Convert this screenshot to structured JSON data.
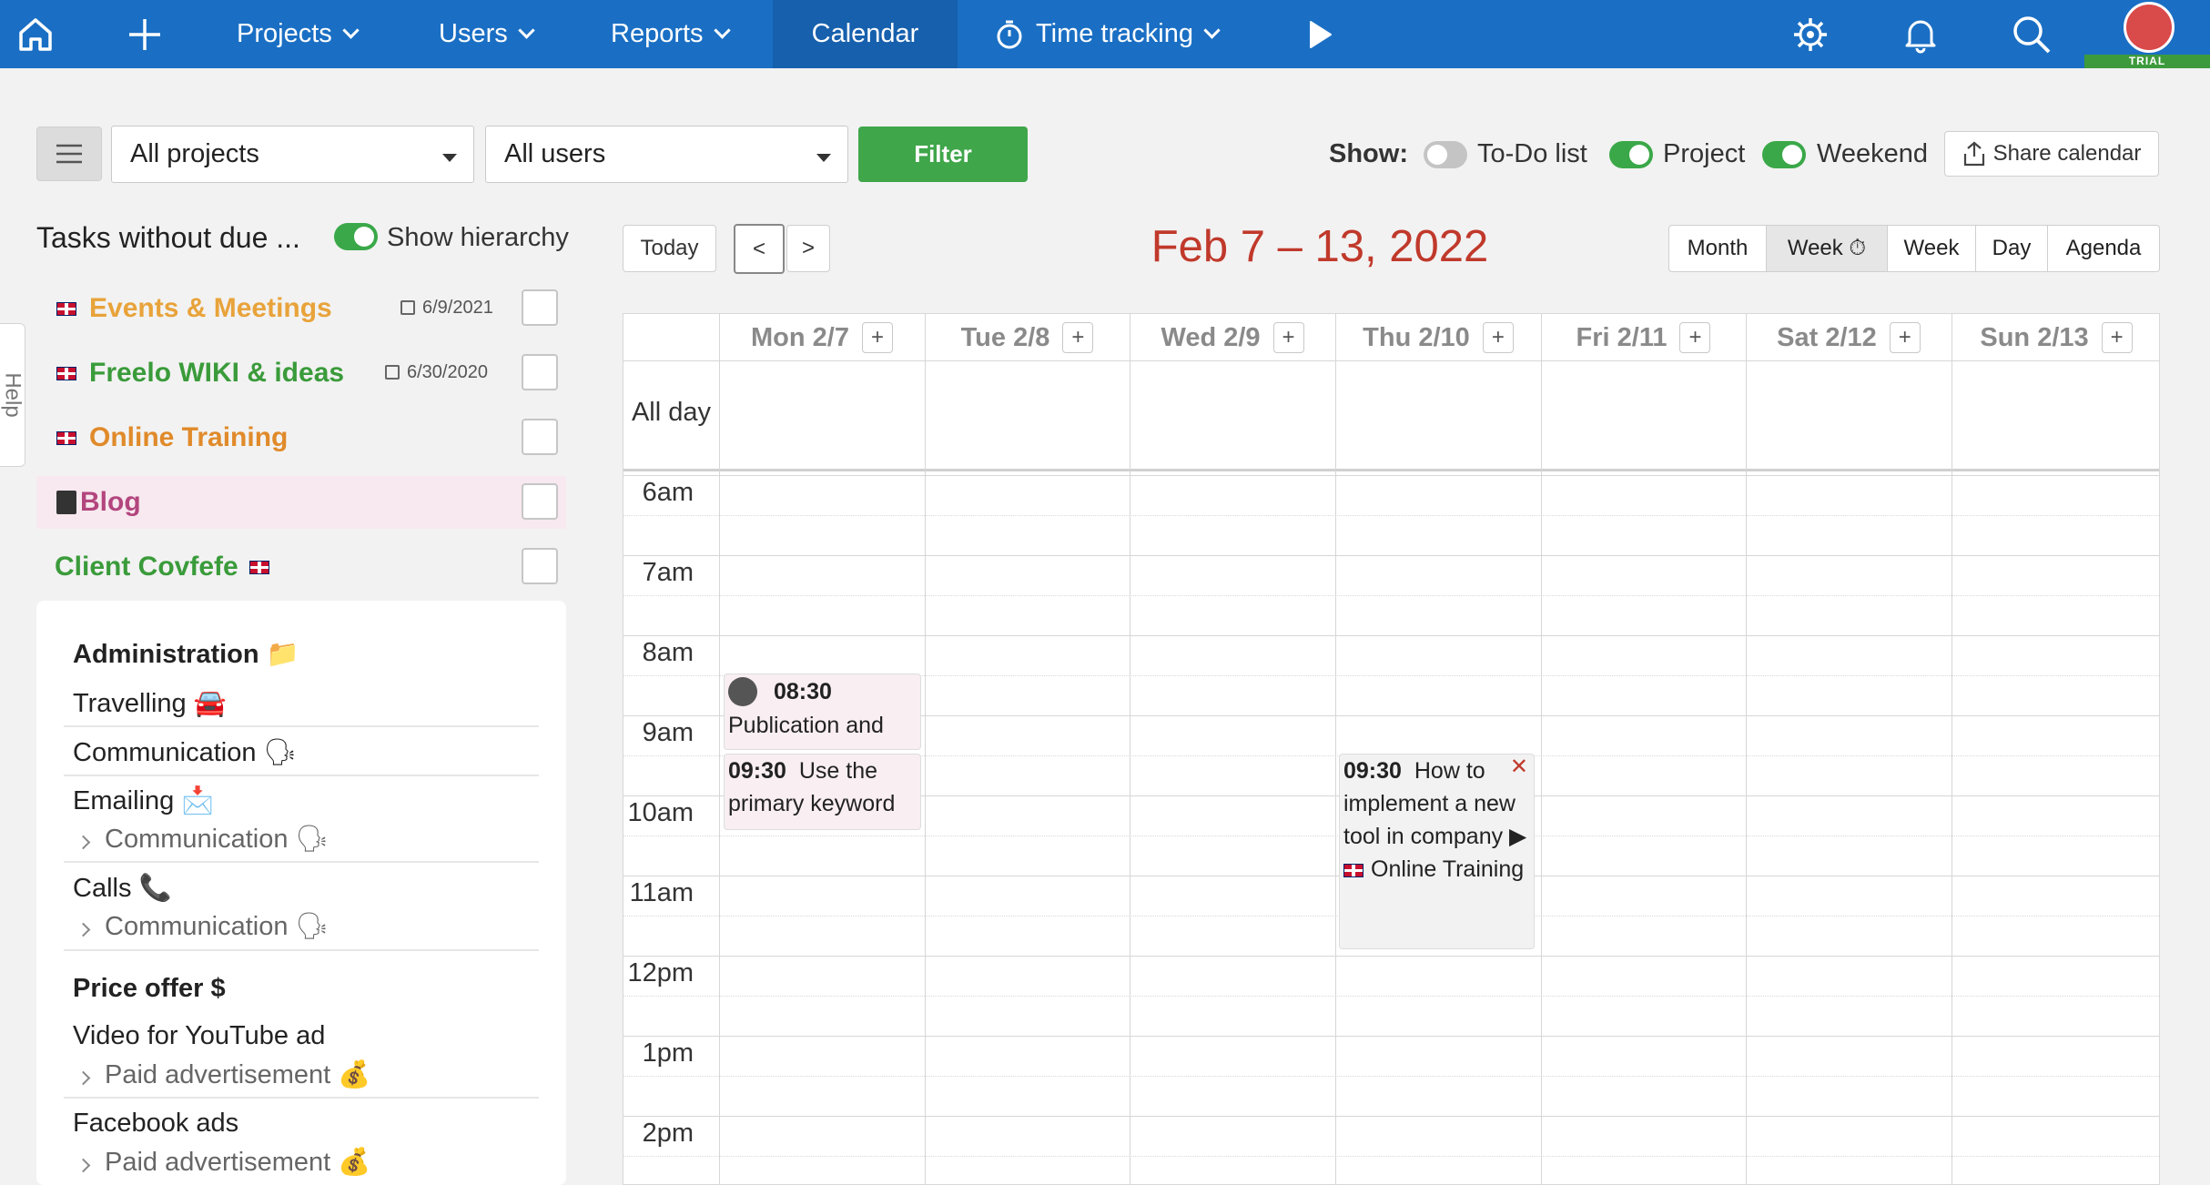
{
  "nav": {
    "projects": "Projects",
    "users": "Users",
    "reports": "Reports",
    "calendar": "Calendar",
    "time_tracking": "Time tracking",
    "trial_badge": "TRIAL"
  },
  "toolbar": {
    "project_select": "All projects",
    "user_select": "All users",
    "filter_label": "Filter",
    "show_label": "Show:",
    "todo_label": "To-Do list",
    "todo_on": false,
    "project_label": "Project",
    "project_on": true,
    "weekend_label": "Weekend",
    "weekend_on": true,
    "share_label": "Share calendar"
  },
  "sidebar": {
    "title": "Tasks without due ...",
    "hierarchy_label": "Show hierarchy",
    "projects": [
      {
        "name": "Events & Meetings",
        "date": "6/9/2021",
        "color": "#e8a33a"
      },
      {
        "name": "Freelo WIKI & ideas",
        "date": "6/30/2020",
        "color": "#3a9b3a"
      },
      {
        "name": "Online Training",
        "date": "",
        "color": "#e08a2a"
      },
      {
        "name": "Blog",
        "date": "",
        "color": "#b3457e"
      },
      {
        "name": "Client Covfefe",
        "date": "",
        "color": "#3a9b3a"
      }
    ],
    "tasks": {
      "group1": "Administration 📁",
      "travelling": "Travelling 🚘",
      "communication": "Communication 🗣",
      "emailing": "Emailing 📩",
      "emailing_sub": "Communication 🗣",
      "calls": "Calls 📞",
      "calls_sub": "Communication 🗣",
      "group2": "Price offer $",
      "video": "Video for YouTube ad",
      "video_sub": "Paid advertisement 💰",
      "facebook": "Facebook ads",
      "facebook_sub": "Paid advertisement 💰"
    },
    "help_tab": "Help"
  },
  "calendar": {
    "today_label": "Today",
    "prev_label": "<",
    "next_label": ">",
    "range_title": "Feb 7 – 13, 2022",
    "views": [
      "Month",
      "Week ⏱",
      "Week",
      "Day",
      "Agenda"
    ],
    "days": [
      "Mon 2/7",
      "Tue 2/8",
      "Wed 2/9",
      "Thu 2/10",
      "Fri 2/11",
      "Sat 2/12",
      "Sun 2/13"
    ],
    "all_day": "All day",
    "hours": [
      "6am",
      "7am",
      "8am",
      "9am",
      "10am",
      "11am",
      "12pm",
      "1pm",
      "2pm"
    ],
    "events": [
      {
        "time": "08:30",
        "text": "Publication and"
      },
      {
        "time": "09:30",
        "text": "Use the primary keyword"
      },
      {
        "time": "09:30",
        "text": "How to implement a new tool in company ▶",
        "project": "Online Training"
      }
    ],
    "accent": "#c0392b"
  }
}
